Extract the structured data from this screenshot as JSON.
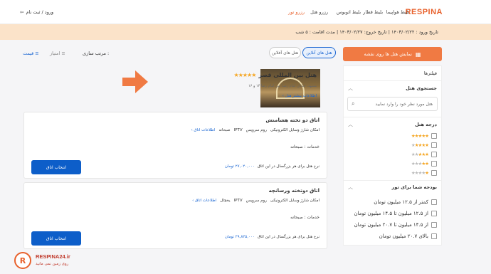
{
  "header": {
    "logo": "RESPINA",
    "nav": [
      "بلیط هواپیما",
      "بلیط قطار",
      "بلیط اتوبوس",
      "رزرو هتل",
      "رزرو تور"
    ],
    "login": "ورود / ثبت نام"
  },
  "datebar": {
    "text": "تاریخ ورود : ۱۴۰۳/۰۲/۲۲ | تاریخ خروج: ۱۴۰۳/۰۲/۲۷ | مدت اقامت : ۵ شب"
  },
  "sidebar": {
    "map_button": "نمایش هتل ها روی نقشه",
    "filters_title": "فیلترها",
    "search_title": "جستجوی هتل",
    "search_placeholder": "هتل مورد نظر خود را وارد نمایید",
    "stars_title": "درجه هتل",
    "star_levels": [
      5,
      4,
      3,
      2,
      1
    ],
    "budget_title": "بودجه شما برای تور",
    "budget_options": [
      "کمتر از ۱۲.۵ میلیون تومان",
      "از ۱۲.۵ میلیون تا ۱۴.۵ میلیون تومان",
      "از ۱۴.۵ میلیون تا ۲۰.۷ میلیون تومان",
      "بالای ۲۰.۷ میلیون تومان"
    ]
  },
  "toolbar": {
    "tab_online": "هتل های آنلاین",
    "tab_offline": "هتل های آفلاین",
    "sort_label": "مرتب سازی :",
    "sort_rating": "امتیاز",
    "sort_price": "قیمت"
  },
  "hotel": {
    "name": "هتل بین المللی قصر",
    "stars": 5,
    "address": "مشهد، خیابان امام رضا، بین امام رضا ۱۴ و ۱۶",
    "more_info": "اطلاعات بیشتر هتل"
  },
  "rooms": [
    {
      "title": "اتاق دو تخته هشامنش",
      "amenities": [
        "امکان شارژ وسایل الکترونیکی",
        "روم سرویس",
        "IPTV",
        "صبحانه"
      ],
      "room_info": "اطلاعات اتاق",
      "services": "خدمات : صبحانه",
      "price_label": "نرخ هتل برای هر بزرگسال در این اتاق",
      "price": "۲۷,۰۲۰,۰۰۰ تومان",
      "select": "انتخاب اتاق"
    },
    {
      "title": "اتاق دوتخته ورسانچه",
      "amenities": [
        "امکان شارژ وسایل الکترونیکی",
        "روم سرویس",
        "IPTV",
        "یخچال"
      ],
      "room_info": "اطلاعات اتاق",
      "services": "خدمات : صبحانه",
      "price_label": "نرخ هتل برای هر بزرگسال در این اتاق",
      "price": "۲۹,۸۲۵,۰۰۰ تومان",
      "select": "انتخاب اتاق"
    }
  ],
  "watermark": {
    "brand": "RESPINA24.ir",
    "tagline": "روی زمین نمی مانید"
  },
  "colors": {
    "accent": "#e8612c",
    "blue": "#0d5ec9",
    "banner": "#fbe3c9"
  }
}
